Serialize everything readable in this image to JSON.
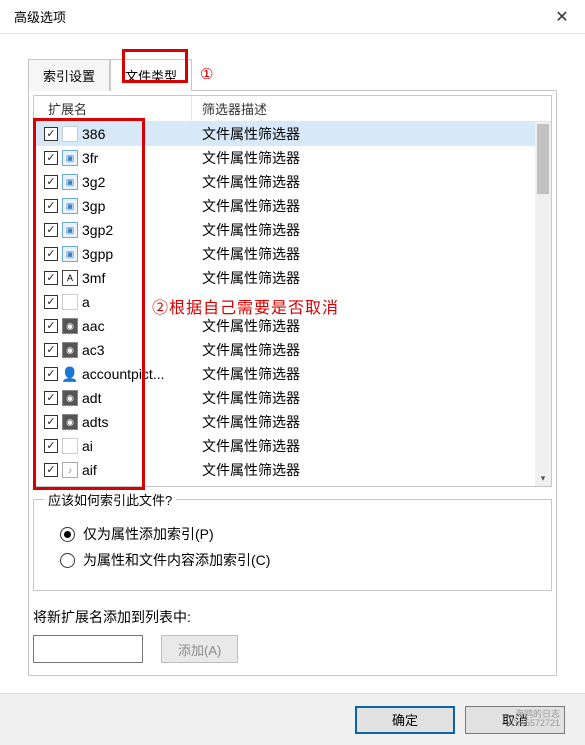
{
  "window": {
    "title": "高级选项"
  },
  "tabs": {
    "index_settings": "索引设置",
    "file_types": "文件类型"
  },
  "annotation": {
    "tab_marker": "①",
    "list_text": "②根据自己需要是否取消"
  },
  "headers": {
    "ext": "扩展名",
    "desc": "筛选器描述"
  },
  "rows": [
    {
      "checked": true,
      "ext": "386",
      "desc": "文件属性筛选器",
      "icon": "",
      "selected": true
    },
    {
      "checked": true,
      "ext": "3fr",
      "desc": "文件属性筛选器",
      "icon": "blue"
    },
    {
      "checked": true,
      "ext": "3g2",
      "desc": "文件属性筛选器",
      "icon": "blue"
    },
    {
      "checked": true,
      "ext": "3gp",
      "desc": "文件属性筛选器",
      "icon": "blue"
    },
    {
      "checked": true,
      "ext": "3gp2",
      "desc": "文件属性筛选器",
      "icon": "blue"
    },
    {
      "checked": true,
      "ext": "3gpp",
      "desc": "文件属性筛选器",
      "icon": "blue"
    },
    {
      "checked": true,
      "ext": "3mf",
      "desc": "文件属性筛选器",
      "icon": "a"
    },
    {
      "checked": true,
      "ext": "a",
      "desc": "",
      "icon": ""
    },
    {
      "checked": true,
      "ext": "aac",
      "desc": "文件属性筛选器",
      "icon": "dark"
    },
    {
      "checked": true,
      "ext": "ac3",
      "desc": "文件属性筛选器",
      "icon": "dark"
    },
    {
      "checked": true,
      "ext": "accountpict...",
      "desc": "文件属性筛选器",
      "icon": "person"
    },
    {
      "checked": true,
      "ext": "adt",
      "desc": "文件属性筛选器",
      "icon": "dark"
    },
    {
      "checked": true,
      "ext": "adts",
      "desc": "文件属性筛选器",
      "icon": "dark"
    },
    {
      "checked": true,
      "ext": "ai",
      "desc": "文件属性筛选器",
      "icon": ""
    },
    {
      "checked": true,
      "ext": "aif",
      "desc": "文件属性筛选器",
      "icon": "aud"
    }
  ],
  "index_group": {
    "legend": "应该如何索引此文件?",
    "opt1": "仅为属性添加索引(P)",
    "opt2": "为属性和文件内容添加索引(C)"
  },
  "add_ext": {
    "label": "将新扩展名添加到列表中:",
    "button": "添加(A)"
  },
  "footer": {
    "ok": "确定",
    "cancel": "取消",
    "watermark1": "海鸥的日志",
    "watermark2": "ID:65572721"
  }
}
